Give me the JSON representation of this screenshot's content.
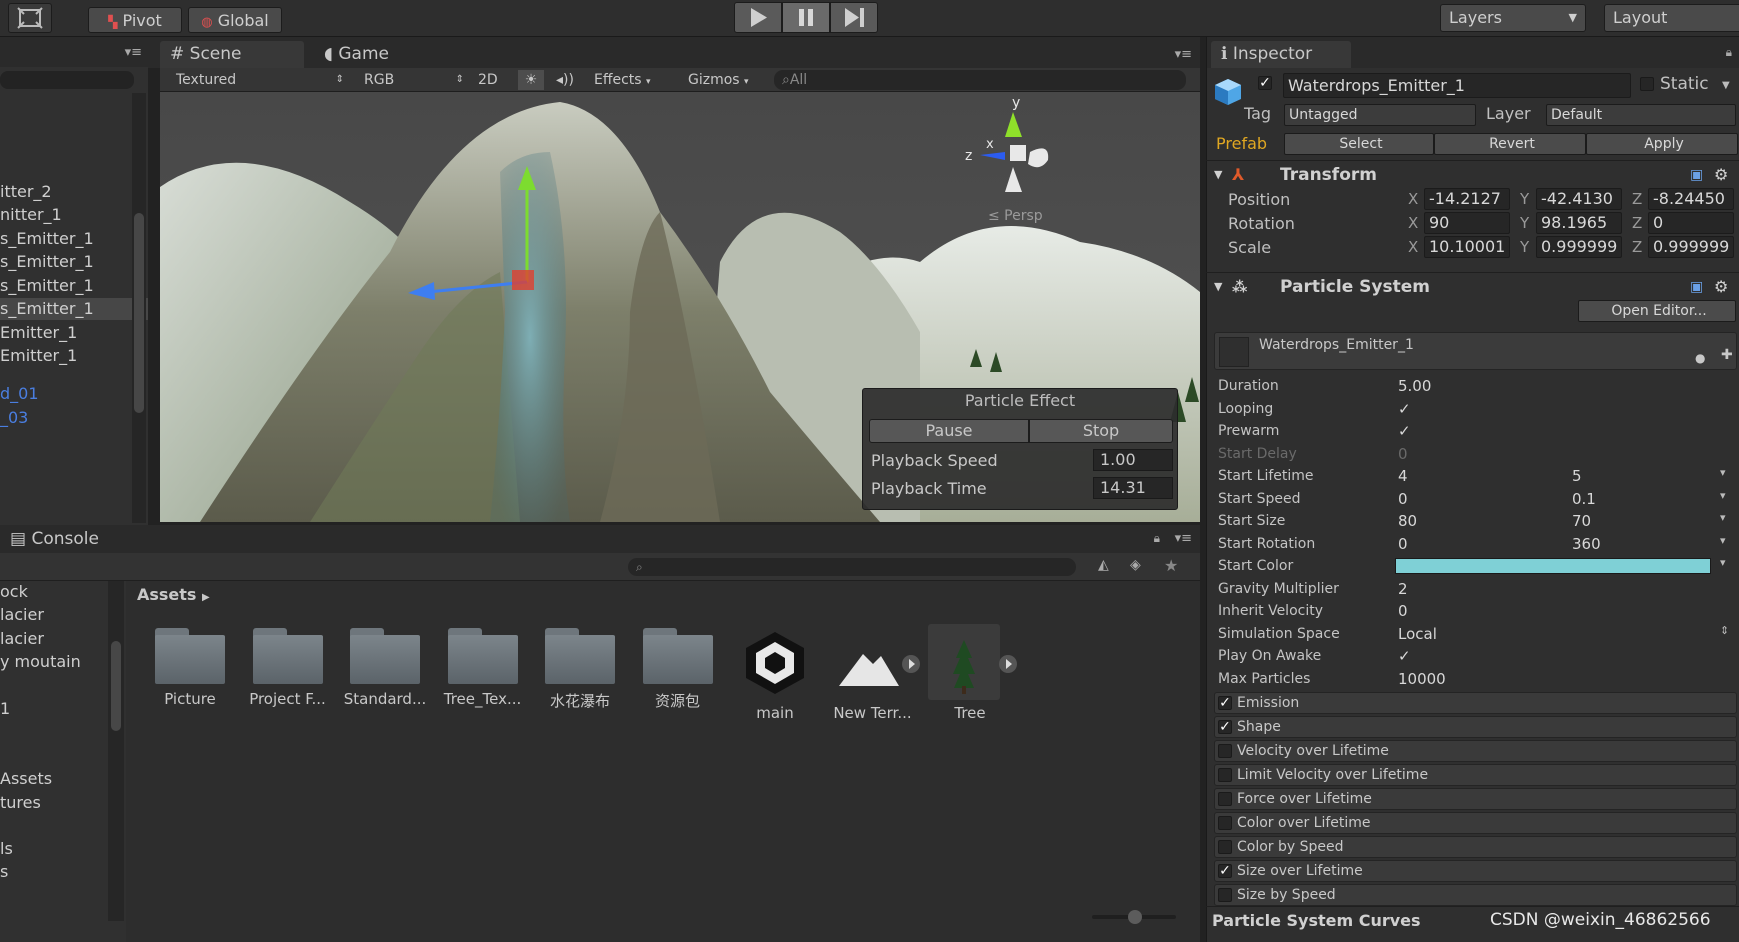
{
  "toolbar": {
    "pivot": "Pivot",
    "global": "Global",
    "layers": "Layers",
    "layout": "Layout"
  },
  "tabs": {
    "scene": "Scene",
    "game": "Game",
    "inspector": "Inspector",
    "console": "Console"
  },
  "scene_toolbar": {
    "shading": "Textured",
    "channel": "RGB",
    "mode_2d": "2D",
    "effects": "Effects",
    "gizmos": "Gizmos",
    "search_placeholder": "All"
  },
  "hierarchy": {
    "items": [
      "itter_2",
      "nitter_1",
      "s_Emitter_1",
      "s_Emitter_1",
      "s_Emitter_1",
      "s_Emitter_1",
      "Emitter_1",
      "Emitter_1",
      "d_01",
      "_03"
    ]
  },
  "gizmo": {
    "y": "y",
    "x": "x",
    "z": "z",
    "persp": "≤ Persp"
  },
  "particle_effect": {
    "title": "Particle Effect",
    "pause": "Pause",
    "stop": "Stop",
    "playback_speed_label": "Playback Speed",
    "playback_speed": "1.00",
    "playback_time_label": "Playback Time",
    "playback_time": "14.31"
  },
  "project": {
    "left_items": [
      "ock",
      "lacier",
      "lacier",
      "y moutain",
      "1",
      "Assets",
      "tures",
      "ls",
      "s"
    ],
    "breadcrumb": "Assets",
    "assets": [
      {
        "name": "Picture",
        "kind": "folder"
      },
      {
        "name": "Project F...",
        "kind": "folder"
      },
      {
        "name": "Standard...",
        "kind": "folder"
      },
      {
        "name": "Tree_Tex...",
        "kind": "folder"
      },
      {
        "name": "水花瀑布",
        "kind": "folder"
      },
      {
        "name": "资源包",
        "kind": "folder"
      },
      {
        "name": "main",
        "kind": "unity"
      },
      {
        "name": "New Terr...",
        "kind": "terrain"
      },
      {
        "name": "Tree",
        "kind": "tree"
      }
    ]
  },
  "inspector": {
    "object_name": "Waterdrops_Emitter_1",
    "static": "Static",
    "tag_label": "Tag",
    "tag": "Untagged",
    "layer_label": "Layer",
    "layer": "Default",
    "prefab": "Prefab",
    "select": "Select",
    "revert": "Revert",
    "apply": "Apply",
    "transform": {
      "title": "Transform",
      "position_label": "Position",
      "rotation_label": "Rotation",
      "scale_label": "Scale",
      "position": {
        "x": "-14.2127",
        "y": "-42.4130",
        "z": "-8.24450"
      },
      "rotation": {
        "x": "90",
        "y": "98.1965",
        "z": "0"
      },
      "scale": {
        "x": "10.10001",
        "y": "0.999999",
        "z": "0.999999"
      }
    },
    "particle_system": {
      "title": "Particle System",
      "open_editor": "Open Editor...",
      "emitter_name": "Waterdrops_Emitter_1",
      "props": [
        {
          "label": "Duration",
          "v1": "5.00",
          "v2": ""
        },
        {
          "label": "Looping",
          "v1": "✓",
          "v2": ""
        },
        {
          "label": "Prewarm",
          "v1": "✓",
          "v2": ""
        },
        {
          "label": "Start Delay",
          "v1": "0",
          "v2": ""
        },
        {
          "label": "Start Lifetime",
          "v1": "4",
          "v2": "5"
        },
        {
          "label": "Start Speed",
          "v1": "0",
          "v2": "0.1"
        },
        {
          "label": "Start Size",
          "v1": "80",
          "v2": "70"
        },
        {
          "label": "Start Rotation",
          "v1": "0",
          "v2": "360"
        },
        {
          "label": "Start Color",
          "v1": "",
          "v2": ""
        },
        {
          "label": "Gravity Multiplier",
          "v1": "2",
          "v2": ""
        },
        {
          "label": "Inherit Velocity",
          "v1": "0",
          "v2": ""
        },
        {
          "label": "Simulation Space",
          "v1": "Local",
          "v2": ""
        },
        {
          "label": "Play On Awake",
          "v1": "✓",
          "v2": ""
        },
        {
          "label": "Max Particles",
          "v1": "10000",
          "v2": ""
        }
      ],
      "start_color": "#7fd0d6",
      "modules": [
        {
          "label": "Emission",
          "checked": true
        },
        {
          "label": "Shape",
          "checked": true
        },
        {
          "label": "Velocity over Lifetime",
          "checked": false
        },
        {
          "label": "Limit Velocity over Lifetime",
          "checked": false
        },
        {
          "label": "Force over Lifetime",
          "checked": false
        },
        {
          "label": "Color over Lifetime",
          "checked": false
        },
        {
          "label": "Color by Speed",
          "checked": false
        },
        {
          "label": "Size over Lifetime",
          "checked": true
        },
        {
          "label": "Size by Speed",
          "checked": false
        }
      ],
      "curves": "Particle System Curves"
    }
  },
  "watermark": "CSDN @weixin_46862566"
}
